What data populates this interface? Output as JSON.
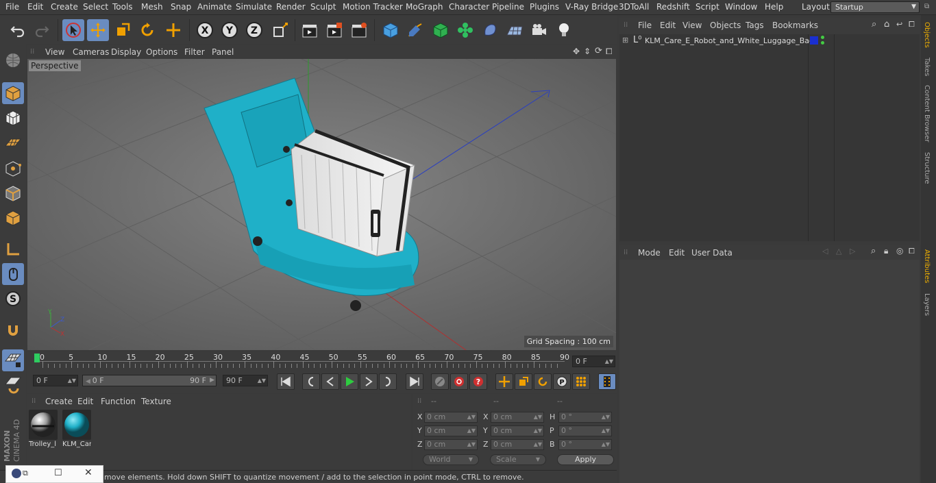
{
  "menubar": {
    "items": [
      "File",
      "Edit",
      "Create",
      "Select",
      "Tools",
      "Mesh",
      "Snap",
      "Animate",
      "Simulate",
      "Render",
      "Sculpt",
      "Motion Tracker",
      "MoGraph",
      "Character",
      "Pipeline",
      "Plugins",
      "V-Ray Bridge",
      "3DToAll",
      "Redshift",
      "Script",
      "Window",
      "Help"
    ],
    "layout_label": "Layout:",
    "layout_value": "Startup"
  },
  "viewport": {
    "menu": [
      "View",
      "Cameras",
      "Display",
      "Options",
      "Filter",
      "Panel"
    ],
    "label": "Perspective",
    "grid_spacing": "Grid Spacing : 100 cm"
  },
  "timeline": {
    "ticks": [
      "0",
      "5",
      "10",
      "15",
      "20",
      "25",
      "30",
      "35",
      "40",
      "45",
      "50",
      "55",
      "60",
      "65",
      "70",
      "75",
      "80",
      "85",
      "90"
    ],
    "current_frame": "0 F"
  },
  "playback": {
    "start": "0 F",
    "range_start": "0 F",
    "range_end": "90 F",
    "end": "90 F"
  },
  "materials": {
    "menu": [
      "Create",
      "Edit",
      "Function",
      "Texture"
    ],
    "items": [
      {
        "name": "Trolley_l"
      },
      {
        "name": "KLM_Car"
      }
    ]
  },
  "coordinates": {
    "headers": [
      "--",
      "--",
      "--"
    ],
    "rows": [
      {
        "a_label": "X",
        "a_value": "0 cm",
        "b_label": "X",
        "b_value": "0 cm",
        "c_label": "H",
        "c_value": "0 °"
      },
      {
        "a_label": "Y",
        "a_value": "0 cm",
        "b_label": "Y",
        "b_value": "0 cm",
        "c_label": "P",
        "c_value": "0 °"
      },
      {
        "a_label": "Z",
        "a_value": "0 cm",
        "b_label": "Z",
        "b_value": "0 cm",
        "c_label": "B",
        "c_value": "0 °"
      }
    ],
    "space": "World",
    "mode": "Scale",
    "apply": "Apply"
  },
  "status": {
    "text": "move elements. Hold down SHIFT to quantize movement / add to the selection in point mode, CTRL to remove."
  },
  "objects": {
    "menu": [
      "File",
      "Edit",
      "View",
      "Objects",
      "Tags",
      "Bookmarks"
    ],
    "items": [
      {
        "name": "KLM_Care_E_Robot_and_White_Luggage_Bag",
        "layer_color": "#1a2fd0"
      }
    ]
  },
  "attributes": {
    "menu": [
      "Mode",
      "Edit",
      "User Data"
    ]
  },
  "right_tabs": [
    "Objects",
    "Takes",
    "Content Browser",
    "Structure",
    "Attributes",
    "Layers"
  ],
  "brand": {
    "line1": "MAXON",
    "line2": "CINEMA 4D"
  },
  "colors": {
    "accent": "#6a8cc0",
    "robot": "#1fb0c8",
    "selected": "#6a8cc0"
  }
}
